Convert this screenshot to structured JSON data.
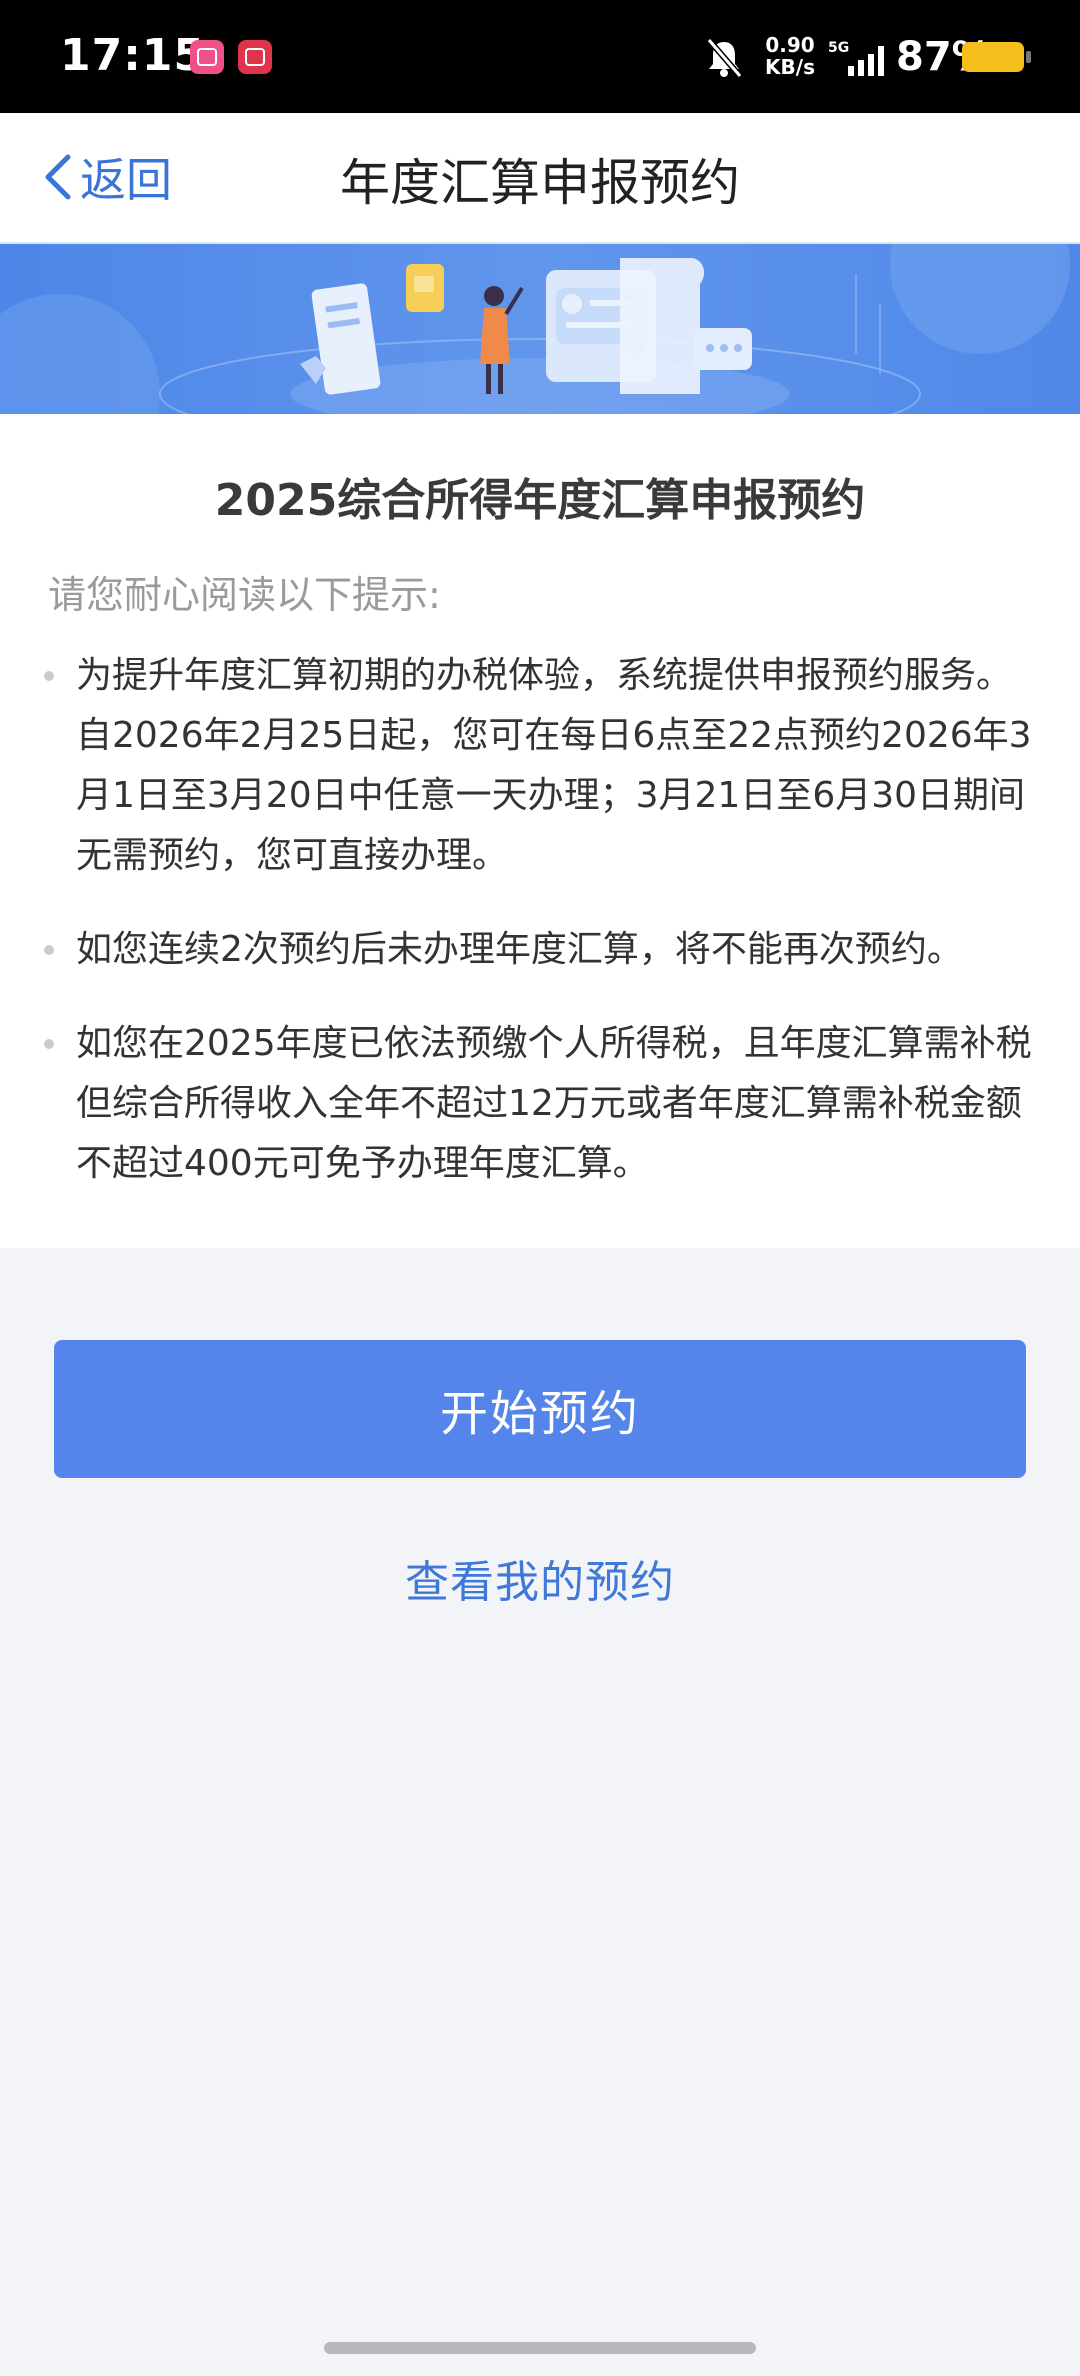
{
  "status_bar": {
    "time": "17:15",
    "net_speed_value": "0.90",
    "net_speed_unit": "KB/s",
    "network_type": "5G",
    "battery_percent": "87%",
    "battery_color": "#f6be1a",
    "icons": [
      "app-icon",
      "app-icon",
      "bell-muted-icon",
      "signal-icon",
      "battery-icon"
    ]
  },
  "nav": {
    "back_label": "返回",
    "title": "年度汇算申报预约"
  },
  "content": {
    "title": "2025综合所得年度汇算申报预约",
    "hint": "请您耐心阅读以下提示:",
    "notices": [
      "为提升年度汇算初期的办税体验，系统提供申报预约服务。自2026年2月25日起，您可在每日6点至22点预约2026年3月1日至3月20日中任意一天办理；3月21日至6月30日期间无需预约，您可直接办理。",
      "如您连续2次预约后未办理年度汇算，将不能再次预约。",
      "如您在2025年度已依法预缴个人所得税，且年度汇算需补税但综合所得收入全年不超过12万元或者年度汇算需补税金额不超过400元可免予办理年度汇算。"
    ]
  },
  "actions": {
    "start_label": "开始预约",
    "view_label": "查看我的预约"
  },
  "colors": {
    "primary": "#5585ea",
    "link": "#3f78d8",
    "page_bg": "#f3f4f8"
  }
}
